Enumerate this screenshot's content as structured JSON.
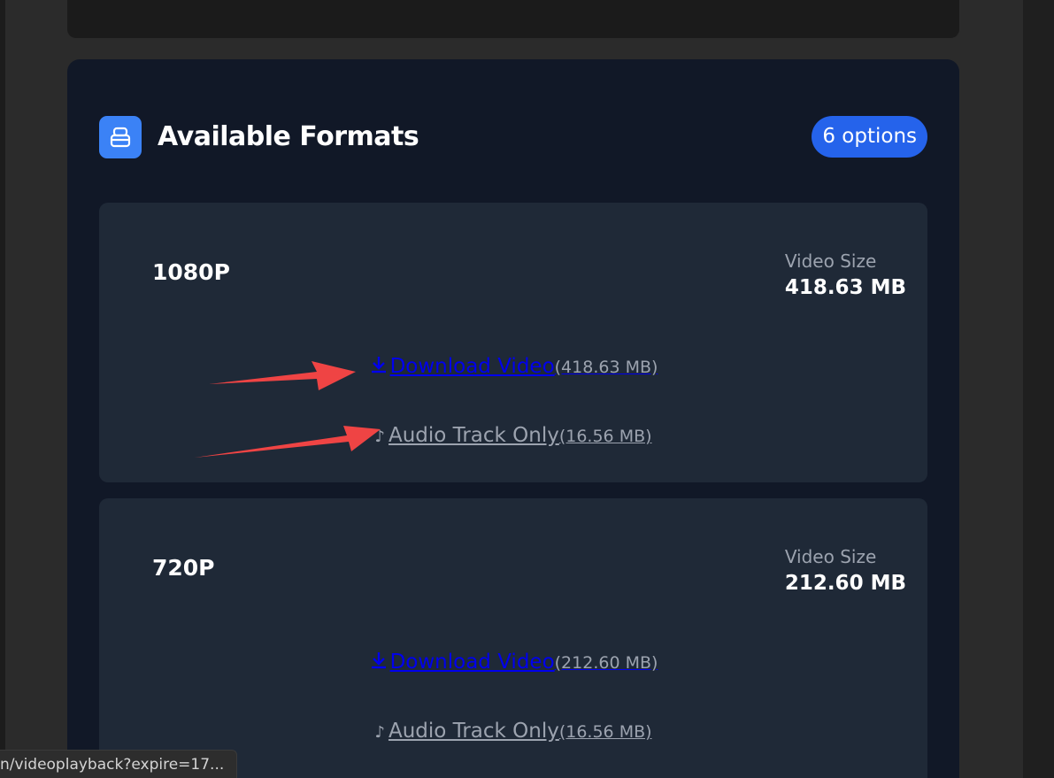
{
  "panel": {
    "title": "Available Formats",
    "badge": "6 options",
    "icon": "storage-icon"
  },
  "formats": [
    {
      "resolution": "1080P",
      "size_label": "Video Size",
      "size_value": "418.63 MB",
      "download_label": "Download Video",
      "download_size": "(418.63 MB)",
      "audio_label": "Audio Track Only",
      "audio_size": "(16.56 MB)"
    },
    {
      "resolution": "720P",
      "size_label": "Video Size",
      "size_value": "212.60 MB",
      "download_label": "Download Video",
      "download_size": "(212.60 MB)",
      "audio_label": "Audio Track Only",
      "audio_size": "(16.56 MB)"
    }
  ],
  "status_bar": {
    "url": "n/videoplayback?expire=17..."
  },
  "colors": {
    "panel_bg": "#111827",
    "card_bg": "#1f2937",
    "accent": "#3b82f6",
    "badge": "#2563eb",
    "link": "#0000ee",
    "annotation_arrow": "#ef4444"
  }
}
